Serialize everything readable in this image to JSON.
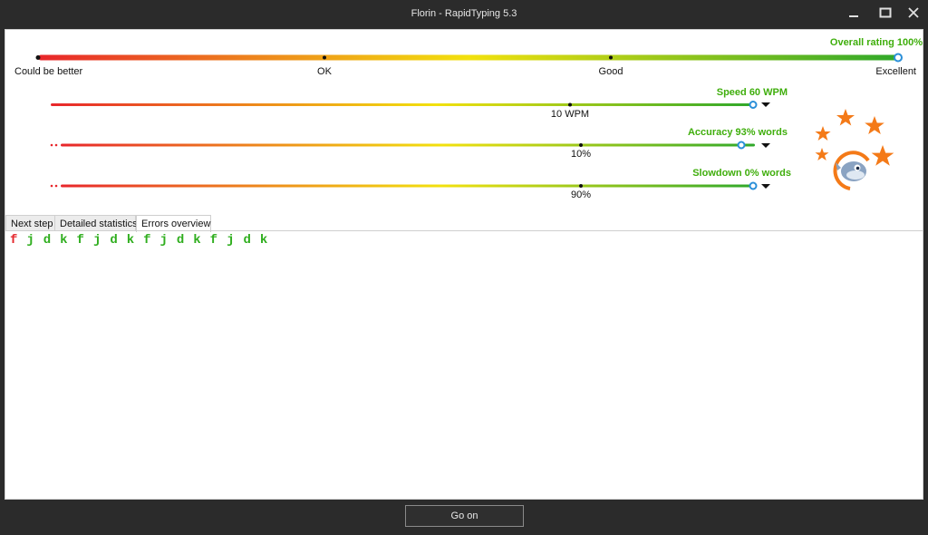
{
  "window": {
    "title": "Florin - RapidTyping 5.3"
  },
  "overall": {
    "label": "Overall rating 100%",
    "value": 100,
    "ticks": [
      "Could be better",
      "OK",
      "Good",
      "Excellent"
    ]
  },
  "metrics": [
    {
      "label": "Speed 60 WPM",
      "marker_label": "10 WPM",
      "value": 60
    },
    {
      "label": "Accuracy 93% words",
      "marker_label": "10%",
      "value": 93
    },
    {
      "label": "Slowdown 0% words",
      "marker_label": "90%",
      "value": 0
    }
  ],
  "tabs": [
    {
      "label": "Next step",
      "active": false
    },
    {
      "label": "Detailed statistics",
      "active": false
    },
    {
      "label": "Errors overview",
      "active": true
    }
  ],
  "errors_overview": {
    "chars": [
      "f",
      "j",
      "d",
      "k",
      "f",
      "j",
      "d",
      "k",
      "f",
      "j",
      "d",
      "k",
      "f",
      "j",
      "d",
      "k"
    ],
    "error_indices": [
      0
    ]
  },
  "footer": {
    "go_on_label": "Go on"
  },
  "colors": {
    "gradient_start": "#e8262b",
    "gradient_mid": "#f2e10e",
    "gradient_end": "#2fa82a",
    "label_green": "#3fae0c",
    "marker_blue": "#2a8fd8",
    "star_orange": "#f47a18"
  }
}
